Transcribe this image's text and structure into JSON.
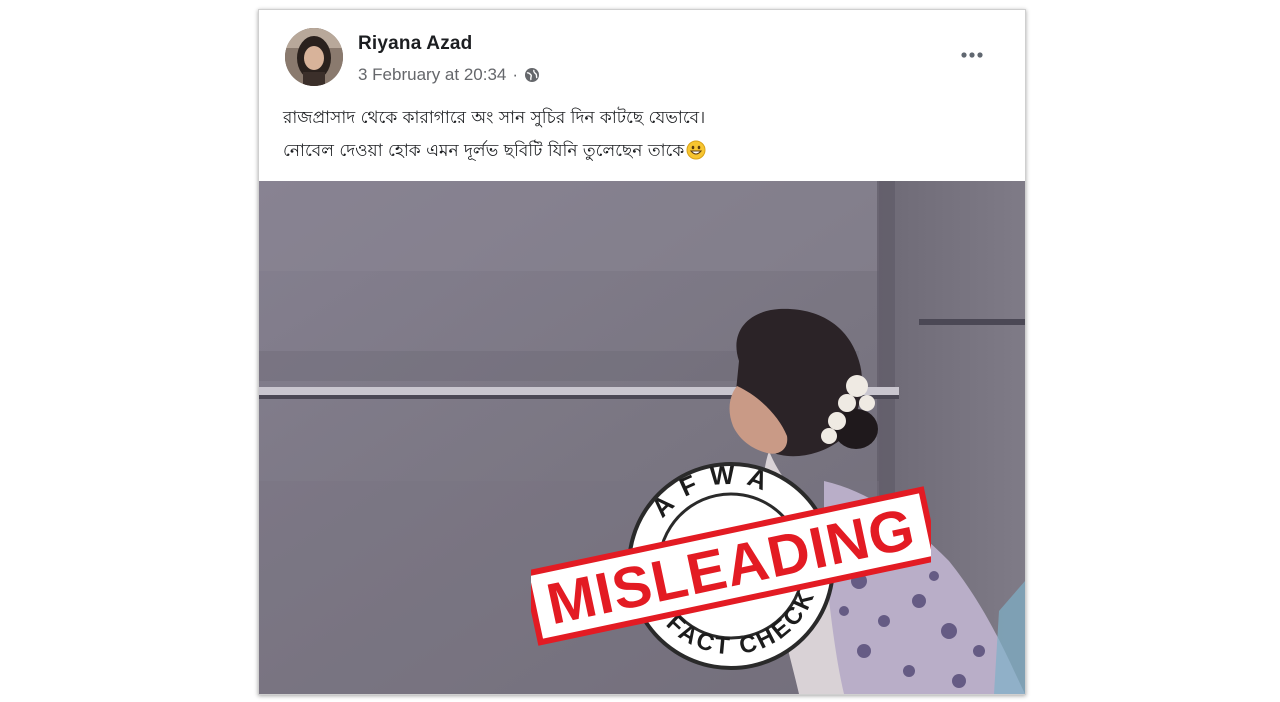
{
  "post": {
    "author_name": "Riyana Azad",
    "timestamp": "3 February at 20:34",
    "separator": "·",
    "privacy_icon": "globe-icon",
    "more_icon": "more-options-icon",
    "text_line_1": "রাজপ্রাসাদ থেকে কারাগারে অং সান সুচির দিন কাটছে যেভাবে।",
    "text_line_2": "নোবেল দেওয়া হোক এমন দূর্লভ ছবিটি যিনি তুলেছেন তাকে",
    "emoji_icon": "grinning-emoji-icon"
  },
  "stamp": {
    "top_text": "AFWA",
    "main_text": "MISLEADING",
    "bottom_text": "FACT CHECK",
    "accent_color": "#e31b23"
  },
  "colors": {
    "wall": "#7e7a85",
    "text": "#1c1e21",
    "meta": "#65676b"
  }
}
